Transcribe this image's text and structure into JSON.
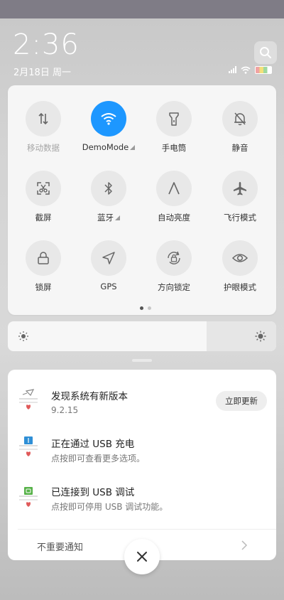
{
  "status": {
    "time": "2:36",
    "date": "2月18日 周一"
  },
  "quick_toggles": [
    {
      "label": "移动数据",
      "icon": "mobile-data-icon",
      "active": false,
      "dim": true
    },
    {
      "label": "DemoMode",
      "icon": "wifi-icon",
      "active": true
    },
    {
      "label": "手电筒",
      "icon": "flashlight-icon",
      "active": false
    },
    {
      "label": "静音",
      "icon": "mute-bell-icon",
      "active": false
    },
    {
      "label": "截屏",
      "icon": "screenshot-icon",
      "active": false
    },
    {
      "label": "蓝牙",
      "icon": "bluetooth-icon",
      "active": false
    },
    {
      "label": "自动亮度",
      "icon": "auto-brightness-icon",
      "active": false
    },
    {
      "label": "飞行模式",
      "icon": "airplane-icon",
      "active": false
    },
    {
      "label": "锁屏",
      "icon": "lock-icon",
      "active": false
    },
    {
      "label": "GPS",
      "icon": "gps-icon",
      "active": false
    },
    {
      "label": "方向锁定",
      "icon": "rotation-lock-icon",
      "active": false
    },
    {
      "label": "护眼模式",
      "icon": "eye-icon",
      "active": false
    }
  ],
  "page_indicator": {
    "count": 2,
    "current": 1
  },
  "notifications": [
    {
      "title": "发现系统有新版本",
      "subtitle": "9.2.15",
      "action": "立即更新",
      "icon": "system-update-icon"
    },
    {
      "title": "正在通过 USB 充电",
      "subtitle": "点按即可查看更多选项。",
      "icon": "usb-icon"
    },
    {
      "title": "已连接到 USB 调试",
      "subtitle": "点按即可停用 USB 调试功能。",
      "icon": "android-debug-icon"
    }
  ],
  "unimportant_label": "不重要通知",
  "colors": {
    "accent": "#1d97ff"
  }
}
